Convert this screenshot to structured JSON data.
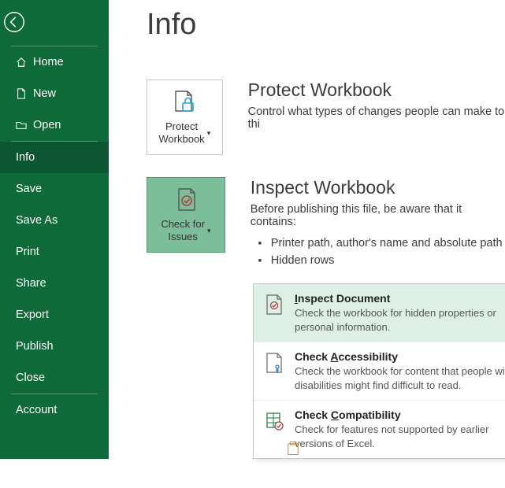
{
  "sidebar": {
    "items": [
      {
        "label": "Home"
      },
      {
        "label": "New"
      },
      {
        "label": "Open"
      },
      {
        "label": "Info"
      },
      {
        "label": "Save"
      },
      {
        "label": "Save As"
      },
      {
        "label": "Print"
      },
      {
        "label": "Share"
      },
      {
        "label": "Export"
      },
      {
        "label": "Publish"
      },
      {
        "label": "Close"
      },
      {
        "label": "Account"
      }
    ]
  },
  "page": {
    "title": "Info"
  },
  "protect": {
    "button_line1": "Protect",
    "button_line2": "Workbook",
    "title": "Protect Workbook",
    "desc": "Control what types of changes people can make to thi"
  },
  "inspect": {
    "button_line1": "Check for",
    "button_line2": "Issues",
    "title": "Inspect Workbook",
    "desc": "Before publishing this file, be aware that it contains:",
    "bullets": [
      "Printer path, author's name and absolute path",
      "Hidden rows"
    ]
  },
  "dropdown": {
    "inspect_doc": {
      "title_pre": "",
      "title_ul": "I",
      "title_post": "nspect Document",
      "desc": "Check the workbook for hidden properties or personal information."
    },
    "accessibility": {
      "title_pre": "Check ",
      "title_ul": "A",
      "title_post": "ccessibility",
      "desc": "Check the workbook for content that people with disabilities might find difficult to read."
    },
    "compatibility": {
      "title_pre": "Check ",
      "title_ul": "C",
      "title_post": "ompatibility",
      "desc": "Check for features not supported by earlier versions of Excel."
    }
  },
  "manage": {
    "title_fragment": ""
  }
}
